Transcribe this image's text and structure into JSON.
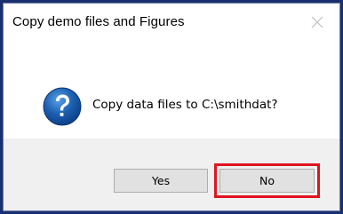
{
  "dialog": {
    "title": "Copy demo files and Figures",
    "message": "Copy data files to C:\\smithdat?",
    "icon": "question-icon",
    "close_icon": "close-icon"
  },
  "buttons": {
    "yes_label": "Yes",
    "no_label": "No"
  },
  "colors": {
    "frame": "#1a2f6e",
    "highlight": "#e0141e",
    "footer": "#f0f0f0",
    "icon_blue": "#1b5fb0"
  }
}
